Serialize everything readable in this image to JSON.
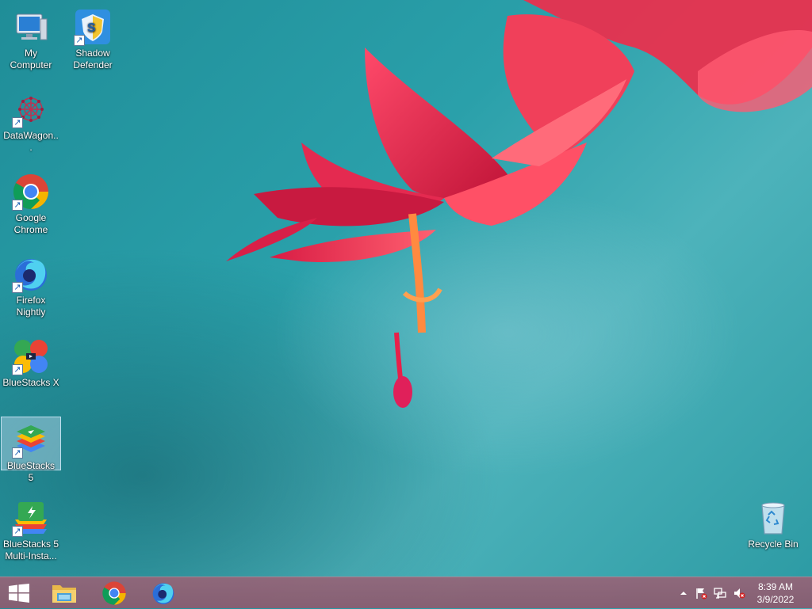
{
  "desktop": {
    "icons": [
      {
        "label": "My Computer"
      },
      {
        "label": "Shadow Defender"
      },
      {
        "label": "DataWagon..."
      },
      {
        "label": "Google Chrome"
      },
      {
        "label": "Firefox Nightly"
      },
      {
        "label": "BlueStacks X"
      },
      {
        "label": "BlueStacks 5"
      },
      {
        "label": "BlueStacks 5 Multi-Insta..."
      },
      {
        "label": "Recycle Bin"
      }
    ]
  },
  "taskbar": {
    "clock": {
      "time": "8:39 AM",
      "date": "3/9/2022"
    }
  },
  "colors": {
    "wallpaper_teal": "#2aa0aa",
    "flower_red": "#e0284a",
    "taskbar": "#8f5e72"
  }
}
